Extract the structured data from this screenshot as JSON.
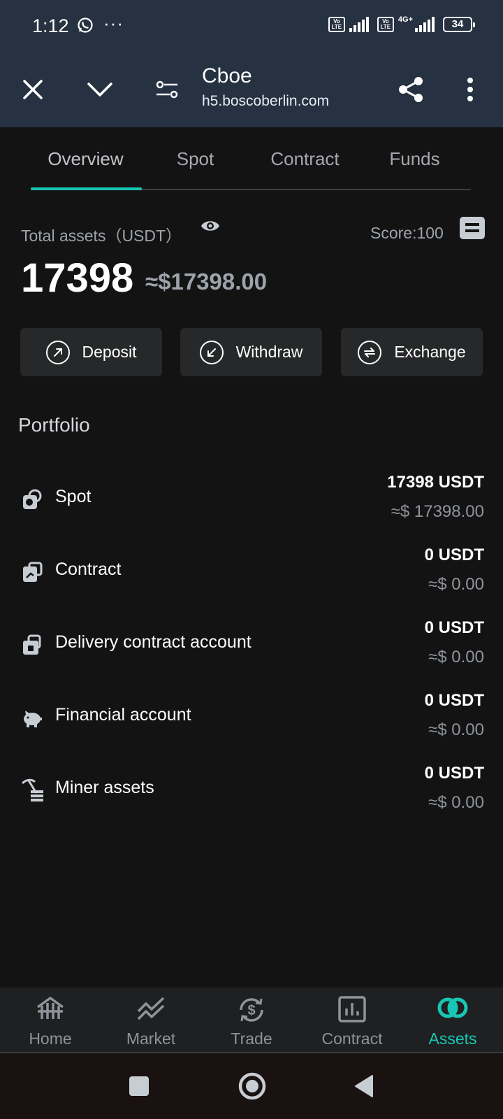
{
  "status_bar": {
    "time": "1:12",
    "more": "···",
    "network_label": "4G+",
    "battery": "34",
    "volte": "Vo LTE"
  },
  "browser": {
    "title": "Cboe",
    "url": "h5.boscoberlin.com"
  },
  "tabs": [
    {
      "label": "Overview",
      "active": true
    },
    {
      "label": "Spot",
      "active": false
    },
    {
      "label": "Contract",
      "active": false
    },
    {
      "label": "Funds",
      "active": false
    }
  ],
  "summary": {
    "total_label": "Total assets（USDT）",
    "score_label": "Score:100",
    "total_value": "17398",
    "total_usd": "≈$17398.00"
  },
  "actions": [
    {
      "label": "Deposit",
      "icon": "arrow-up-right-circle-icon"
    },
    {
      "label": "Withdraw",
      "icon": "arrow-down-left-circle-icon"
    },
    {
      "label": "Exchange",
      "icon": "exchange-circle-icon"
    }
  ],
  "portfolio": {
    "title": "Portfolio",
    "items": [
      {
        "name": "Spot",
        "amount": "17398 USDT",
        "usd": "≈$ 17398.00",
        "icon": "spot-icon"
      },
      {
        "name": "Contract",
        "amount": "0 USDT",
        "usd": "≈$ 0.00",
        "icon": "contract-icon"
      },
      {
        "name": "Delivery contract account",
        "amount": "0 USDT",
        "usd": "≈$ 0.00",
        "icon": "delivery-contract-icon"
      },
      {
        "name": "Financial account",
        "amount": "0 USDT",
        "usd": "≈$ 0.00",
        "icon": "piggy-bank-icon"
      },
      {
        "name": "Miner assets",
        "amount": "0 USDT",
        "usd": "≈$ 0.00",
        "icon": "pickaxe-icon"
      }
    ]
  },
  "bottom_nav": [
    {
      "label": "Home",
      "icon": "home-icon",
      "active": false
    },
    {
      "label": "Market",
      "icon": "market-chart-icon",
      "active": false
    },
    {
      "label": "Trade",
      "icon": "trade-dollar-icon",
      "active": false
    },
    {
      "label": "Contract",
      "icon": "bar-chart-icon",
      "active": false
    },
    {
      "label": "Assets",
      "icon": "assets-icon",
      "active": true
    }
  ],
  "colors": {
    "accent": "#17c7b3",
    "header_bg": "#263141",
    "page_bg": "#131313",
    "button_bg": "#262829",
    "muted_text": "#9ea3ab"
  }
}
